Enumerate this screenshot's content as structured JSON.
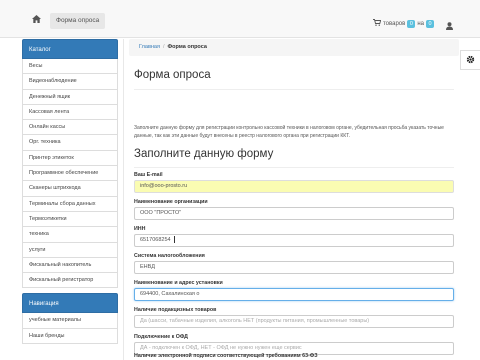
{
  "topbar": {
    "nav_link": "Форма опроса",
    "cart_label": "товаров",
    "cart_count": "0",
    "cart_on": "на",
    "cart_sum": "0"
  },
  "sidebar": {
    "catalog_title": "Каталог",
    "catalog_items": [
      "Весы",
      "Видеонаблюдение",
      "Денежный ящик",
      "Кассовая лента",
      "Онлайн кассы",
      "Орг. техника",
      "Принтер этикеток",
      "Программное обеспечение",
      "Сканеры штрихкода",
      "Терминалы сбора данных",
      "Термоэтикетки",
      "техника",
      "услуги",
      "Фискальный накопитель",
      "Фискальный регистратор"
    ],
    "nav_title": "Навигация",
    "nav_items": [
      "учебные материалы",
      "Наши бренды"
    ]
  },
  "main": {
    "breadcrumb_home": "Главная",
    "breadcrumb_sep": "/",
    "breadcrumb_current": "Форма опроса",
    "page_title": "Форма опроса",
    "intro": "Заполните данную форму для регистрации контрольно кассовой техники в налоговом органе, убедительная просьба указать точные данные, так как эти данные будут внесены в реестр налогового органа при регистрации ККТ.",
    "form_title": "Заполните данную форму",
    "fields": [
      {
        "label": "Ваш E-mail",
        "value": "info@ooo-prosto.ru"
      },
      {
        "label": "Наименование организации",
        "value": "ООО \"ПРОСТО\""
      },
      {
        "label": "ИНН",
        "value": "6517068254"
      },
      {
        "label": "Система налогообложения",
        "value": "ЕНВД"
      },
      {
        "label": "Наименование и адрес установки",
        "value": "694400, Сахалинская о"
      },
      {
        "label": "Наличие подакцизных товаров",
        "placeholder": "Да (шасси, табачные изделия, алкоголь НЕТ (продукты питания, промышленные товары)"
      },
      {
        "label": "Подключение к ОФД",
        "placeholder": "ДА - подключен к ОФД, НЕТ - ОФД не нужно нужен еще сервис"
      },
      {
        "label": "Наличие электронной подписи соответствующей требованиям 63-ФЗ"
      }
    ]
  }
}
